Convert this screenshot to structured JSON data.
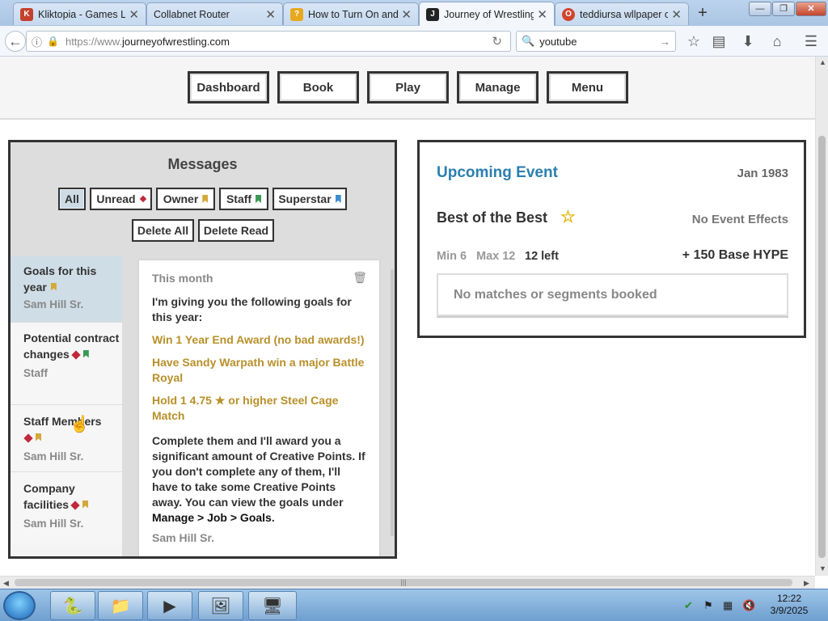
{
  "browser": {
    "tabs": [
      {
        "title": "Kliktopia - Games Li",
        "fav": "K",
        "fav_color": "#c4412b"
      },
      {
        "title": "Collabnet Router",
        "fav": "",
        "fav_color": "#ffffff"
      },
      {
        "title": "How to Turn On and",
        "fav": "?",
        "fav_color": "#e8a81e"
      },
      {
        "title": "Journey of Wrestling",
        "fav": "J",
        "fav_color": "#222222"
      },
      {
        "title": "teddiursa wllpaper c",
        "fav": "O",
        "fav_color": "#d2452d"
      }
    ],
    "url_prefix": "https://www.",
    "url_domain": "journeyofwrestling.com",
    "search_value": "youtube"
  },
  "nav": {
    "buttons": [
      "Dashboard",
      "Book",
      "Play",
      "Manage",
      "Menu"
    ]
  },
  "messages": {
    "title": "Messages",
    "filters": [
      "All",
      "Unread",
      "Owner",
      "Staff",
      "Superstar"
    ],
    "actions": [
      "Delete All",
      "Delete Read"
    ],
    "list": [
      {
        "subject": "Goals for this year",
        "from": "Sam Hill Sr."
      },
      {
        "subject": "Potential contract changes",
        "from": "Staff"
      },
      {
        "subject": "Staff Members",
        "from": "Sam Hill Sr."
      },
      {
        "subject": "Company facilities",
        "from": "Sam Hill Sr."
      }
    ],
    "detail": {
      "when": "This month",
      "intro": "I'm giving you the following goals for this year:",
      "goals": [
        "Win 1 Year End Award (no bad awards!)",
        "Have Sandy Warpath win a major Battle Royal",
        "Hold 1 4.75",
        "or higher Steel Cage Match"
      ],
      "body": "Complete them and I'll award you a significant amount of Creative Points. If you don't complete any of them, I'll have to take some Creative Points away. You can view the goals under",
      "path": "Manage > Job > Goals",
      "signature": "Sam Hill Sr."
    }
  },
  "event": {
    "heading": "Upcoming Event",
    "date": "Jan 1983",
    "name": "Best of the Best",
    "effects": "No Event Effects",
    "min": "Min 6",
    "max": "Max 12",
    "left": "12 left",
    "hype": "+ 150 Base HYPE",
    "empty": "No matches or segments booked"
  },
  "taskbar": {
    "time": "12:22",
    "date": "3/9/2025"
  }
}
